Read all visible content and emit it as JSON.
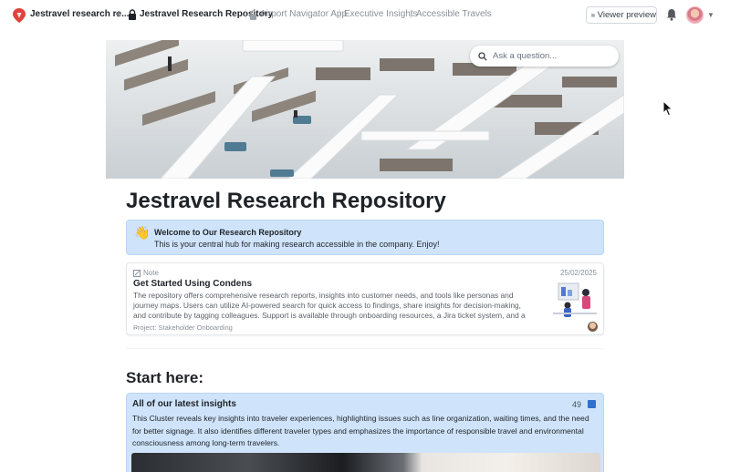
{
  "topbar": {
    "workspace_name": "Jestravel research re...",
    "breadcrumb_active": "Jestravel Research Repository",
    "breadcrumb_items": [
      "Airport Navigator App",
      "Executive Insights",
      "Accessible Travels"
    ],
    "viewer_preview_label": "Viewer preview",
    "icons": [
      "logo-icon",
      "chevron-down-icon",
      "lock-icon",
      "eye-icon",
      "bell-icon",
      "avatar"
    ]
  },
  "search": {
    "placeholder": "Ask a question..."
  },
  "page": {
    "title": "Jestravel Research Repository"
  },
  "callout": {
    "emoji": "👋",
    "title": "Welcome to Our Research Repository",
    "text": "This is your central hub for making research accessible in the company. Enjoy!"
  },
  "note": {
    "type_label": "Note",
    "date": "25/02/2025",
    "title": "Get Started Using Condens",
    "body": "The repository offers comprehensive research reports, insights into customer needs, and tools like personas and journey maps. Users can utilize AI-powered search for quick access to findings, share insights for decision-making, and contribute by tagging colleagues. Support is available through onboarding resources, a Jira ticket system, and a ...",
    "project_label": "Project:",
    "project_name": "Stakeholder Onboarding"
  },
  "section": {
    "start_here": "Start here:"
  },
  "cluster": {
    "title": "All of our latest insights",
    "count": "49",
    "text": "This Cluster reveals key insights into traveler experiences, highlighting issues such as line organization, waiting times, and the need for better signage. It also identifies different traveler types and emphasizes the importance of responsible travel and environmental consciousness among long-term travelers."
  },
  "colors": {
    "callout_bg": "#cfe4fb",
    "accent": "#2f6fd0"
  }
}
